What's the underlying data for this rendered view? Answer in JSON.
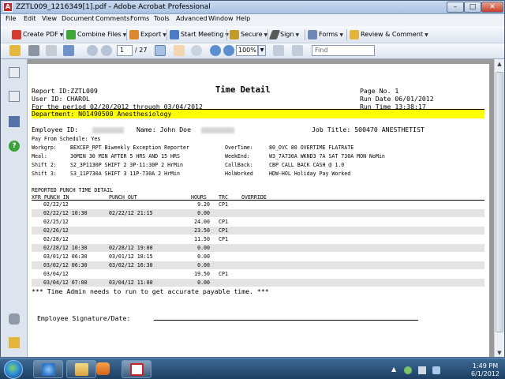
{
  "window": {
    "title": "ZZTL009_1216349[1].pdf - Adobe Acrobat Professional",
    "minimize": "–",
    "maximize": "□",
    "close": "✕",
    "app_icon": "pdf-icon"
  },
  "menu": [
    "File",
    "Edit",
    "View",
    "Document",
    "Comments",
    "Forms",
    "Tools",
    "Advanced",
    "Window",
    "Help"
  ],
  "toolbar": {
    "create_pdf": "Create PDF",
    "combine_files": "Combine Files",
    "export": "Export",
    "start_meeting": "Start Meeting",
    "secure": "Secure",
    "sign": "Sign",
    "forms": "Forms",
    "review_comment": "Review & Comment"
  },
  "nav": {
    "page": "1",
    "total": "/ 27",
    "zoom": "100%",
    "find_placeholder": "Find"
  },
  "report": {
    "header_left": [
      "Report ID:ZZTL009",
      "User ID: CHAROL",
      "For the period   02/20/2012   through   03/04/2012"
    ],
    "title": "Time Detail",
    "header_right": [
      "Page No.   1",
      "Run Date  06/01/2012",
      "Run Time  13:38:17"
    ],
    "department": "Department: NO1490500 Anesthesiology",
    "employee_id_label": "Employee ID:",
    "name_label": "Name: John Doe",
    "job_title": "Job Title:   500470 ANESTHETIST",
    "pay_from_schedule": "Pay From Schedule:       Yes",
    "details_left": [
      [
        "Workgrp:",
        "BEXCEP_RPT Biweekly Exception Reporter"
      ],
      [
        "Meal:",
        "30MIN 30 MIN AFTER 5 HRS AND 15 HRS"
      ],
      [
        "Shift 2:",
        "S2_3P1130P SHIFT 2 3P-11:30P 2 HrMin"
      ],
      [
        "Shift 3:",
        "S3_11P730A SHIFT 3 11P-730A 2 HrMin"
      ]
    ],
    "details_right": [
      [
        "OverTime:",
        "80_OVC 80 OVERTIME FLATRATE"
      ],
      [
        "WeekEnd:",
        "W3_7A730A WKND3 7A SAT 730A MON NoMin"
      ],
      [
        "CallBack:",
        "CBP CALL BACK CASH @ 1.0"
      ],
      [
        "HolWorked",
        "HDW-HOL Holiday Pay Worked"
      ]
    ],
    "section_title": "REPORTED PUNCH TIME DETAIL",
    "columns": [
      "XFR PUNCH IN",
      "PUNCH OUT",
      "HOURS",
      "TRC",
      "OVERRIDE"
    ],
    "rows": [
      {
        "in": "02/22/12",
        "out": "",
        "hours": "9.20",
        "trc": "CP1"
      },
      {
        "in": "02/22/12 10:30",
        "out": "02/22/12 21:15",
        "hours": "0.00",
        "trc": ""
      },
      {
        "in": "02/25/12",
        "out": "",
        "hours": "24.00",
        "trc": "CP1"
      },
      {
        "in": "02/26/12",
        "out": "",
        "hours": "23.50",
        "trc": "CP1"
      },
      {
        "in": "02/28/12",
        "out": "",
        "hours": "11.50",
        "trc": "CP1"
      },
      {
        "in": "02/28/12 10:30",
        "out": "02/28/12 19:00",
        "hours": "0.00",
        "trc": ""
      },
      {
        "in": "03/01/12 06:30",
        "out": "03/01/12 18:15",
        "hours": "0.00",
        "trc": ""
      },
      {
        "in": "03/02/12 06:30",
        "out": "03/02/12 16:30",
        "hours": "0.00",
        "trc": ""
      },
      {
        "in": "03/04/12",
        "out": "",
        "hours": "19.50",
        "trc": "CP1"
      },
      {
        "in": "03/04/12 07:00",
        "out": "03/04/12 11:00",
        "hours": "0.00",
        "trc": ""
      }
    ],
    "note": "*** Time Admin needs to run to get accurate payable time. ***",
    "signature_label": "Employee Signature/Date:"
  },
  "taskbar": {
    "time": "1:49 PM",
    "date": "6/1/2012"
  },
  "colors": {
    "highlight": "#ffff00",
    "titlebar": "#a9c2e2",
    "taskbar": "#1d3f63"
  }
}
